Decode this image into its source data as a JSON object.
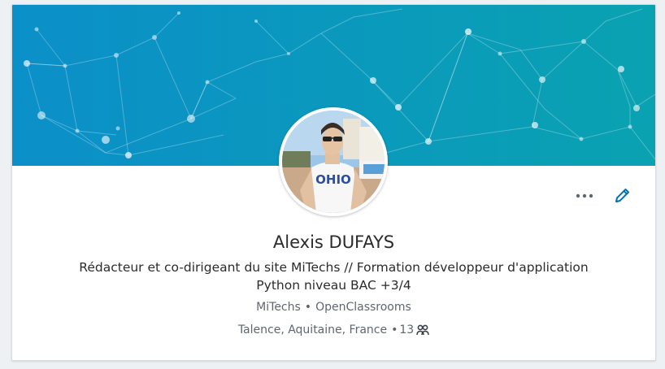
{
  "profile": {
    "name": "Alexis DUFAYS",
    "headline": "Rédacteur et co-dirigeant du site MiTechs // Formation développeur d'application Python niveau BAC +3/4",
    "current_company": "MiTechs",
    "education": "OpenClassrooms",
    "org_separator": "•",
    "location": "Talence, Aquitaine, France",
    "connections_prefix": "•",
    "connections": "13"
  },
  "photo": {
    "shirt_text": "OHIO"
  },
  "actions": {
    "more_icon": "more-horizontal-icon",
    "edit_icon": "pencil-icon"
  },
  "colors": {
    "banner_start": "#0a93c7",
    "banner_end": "#0aa0b2",
    "accent": "#0073b1",
    "text_primary": "#2b2b2b",
    "text_secondary": "#5f6670"
  }
}
